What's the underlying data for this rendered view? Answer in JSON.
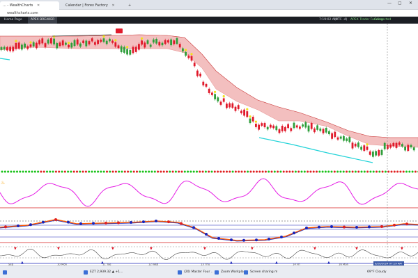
{
  "browser": {
    "tabs": [
      {
        "label": "... - WealthCharts",
        "close": "✕"
      },
      {
        "label": "Calendar | Forex Factory",
        "close": "✕"
      }
    ],
    "new_tab": "+",
    "url": "wealthcharts.com"
  },
  "window_controls": {
    "minimize": "—",
    "maximize": "▢",
    "close": "✕"
  },
  "toolbar": {
    "left_label": "Home Page",
    "button_label": "APEX BREAKER",
    "time": "7:19:02 AM",
    "session": "(UTC -4)",
    "account_label": "APEX Trader Funding",
    "status_label": "Connected"
  },
  "chart": {
    "price_badge": "",
    "date_labels": [
      "Sep",
      "10 Mon",
      "11 Tue",
      "12 Wed",
      "13 Thu",
      "14 Fri",
      "16 Mon",
      "17 Tue"
    ],
    "current_time_tag": "9/20/2024 07:19 AM",
    "colors": {
      "bull": "#2e9e3a",
      "bear": "#e0192a",
      "cloud": "#f0aaaa",
      "cyan": "#22d3d8",
      "magenta": "#e51ce5",
      "blue_line": "#1a24b8",
      "orange_line": "#ff5a00",
      "red_line": "#d81e1e",
      "dot_green": "#19c219",
      "dot_red": "#e02020"
    }
  },
  "taskbar": {
    "items": [
      "",
      "EZT 2,939.32 ▲ +1...",
      "(20) Master Four ...",
      "Zoom Workplace",
      "Screen sharing mee..."
    ],
    "weather": "69°F  Cloudy"
  }
}
